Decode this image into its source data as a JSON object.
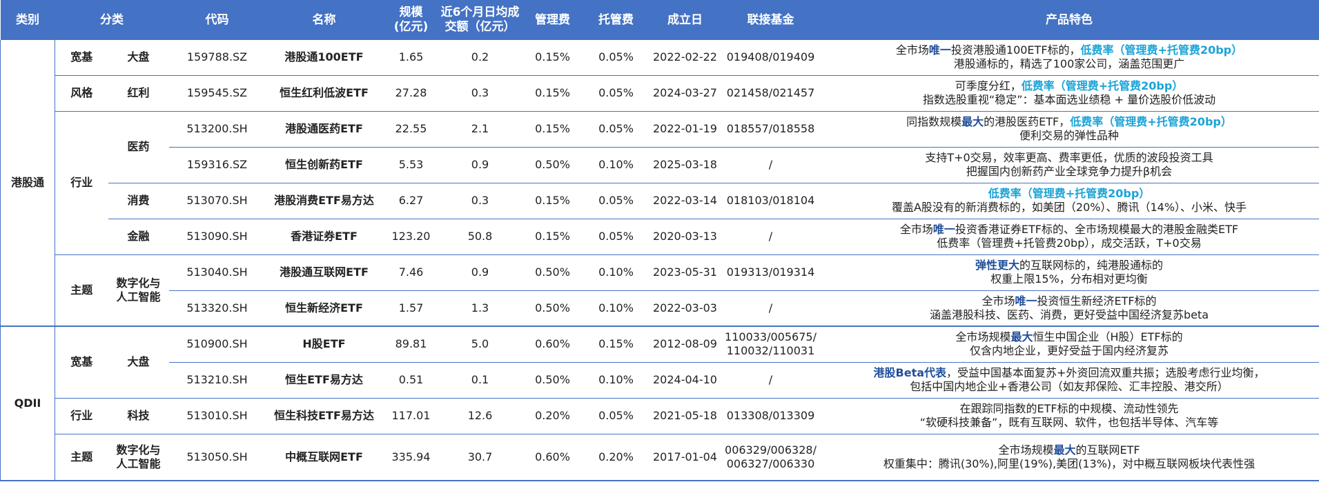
{
  "headers": [
    "类别",
    "分类",
    "代码",
    "名称",
    "规模\n(亿元)",
    "近6个月日均成\n交额（亿元）",
    "管理费",
    "托管费",
    "成立日",
    "联接基金",
    "产品特色"
  ],
  "groups": {
    "hk": "港股通",
    "qdii": "QDII"
  },
  "l1": {
    "kuanji": "宽基",
    "fengge": "风格",
    "hangye": "行业",
    "zhuti": "主题",
    "kuanji2": "宽基",
    "hangye2": "行业",
    "zhuti2": "主题"
  },
  "l2": {
    "dapan": "大盘",
    "hongli": "红利",
    "yiyao": "医药",
    "xiaofei": "消费",
    "jinrong": "金融",
    "shuzi": "数字化与\n人工智能",
    "dapan2": "大盘",
    "keji": "科技",
    "shuzi2": "数字化与\n人工智能"
  },
  "rows": [
    {
      "code": "159788.SZ",
      "name": "港股通100ETF",
      "scale": "1.65",
      "volume": "0.2",
      "mgmt_fee": "0.15%",
      "custody_fee": "0.05%",
      "date": "2022-02-22",
      "link": "019408/019409",
      "f1a": "全市场",
      "f1b": "唯一",
      "f1c": "投资港股通100ETF标的，",
      "f1d": "低费率（管理费+托管费20bp）",
      "f2": "港股通标的，精选了100家公司，涵盖范围更广"
    },
    {
      "code": "159545.SZ",
      "name": "恒生红利低波ETF",
      "scale": "27.28",
      "volume": "0.3",
      "mgmt_fee": "0.15%",
      "custody_fee": "0.05%",
      "date": "2024-03-27",
      "link": "021458/021457",
      "f1a": "可季度分红，",
      "f1b": "低费率（管理费+托管费20bp）",
      "f2": "指数选股重视“稳定”：基本面选业绩稳 + 量价选股价低波动"
    },
    {
      "code": "513200.SH",
      "name": "港股通医药ETF",
      "scale": "22.55",
      "volume": "2.1",
      "mgmt_fee": "0.15%",
      "custody_fee": "0.05%",
      "date": "2022-01-19",
      "link": "018557/018558",
      "f1a": "同指数规模",
      "f1b": "最大",
      "f1c": "的港股医药ETF，",
      "f1d": "低费率（管理费+托管费20bp）",
      "f2": "便利交易的弹性品种"
    },
    {
      "code": "159316.SZ",
      "name": "恒生创新药ETF",
      "scale": "5.53",
      "volume": "0.9",
      "mgmt_fee": "0.50%",
      "custody_fee": "0.10%",
      "date": "2025-03-18",
      "link": "/",
      "f1": "支持T+0交易，效率更高、费率更低，优质的波段投资工具",
      "f2": "把握国内创新药产业全球竞争力提升β机会"
    },
    {
      "code": "513070.SH",
      "name": "港股消费ETF易方达",
      "scale": "6.27",
      "volume": "0.3",
      "mgmt_fee": "0.15%",
      "custody_fee": "0.05%",
      "date": "2022-03-14",
      "link": "018103/018104",
      "f1": "低费率（管理费+托管费20bp）",
      "f2": "覆盖A股没有的新消费标的，如美团（20%）、腾讯（14%）、小米、快手"
    },
    {
      "code": "513090.SH",
      "name": "香港证券ETF",
      "scale": "123.20",
      "volume": "50.8",
      "mgmt_fee": "0.15%",
      "custody_fee": "0.05%",
      "date": "2020-03-13",
      "link": "/",
      "f1a": "全市场",
      "f1b": "唯一",
      "f1c": "投资香港证券ETF标的、全市场规模最大的港股金融类ETF",
      "f2": "低费率（管理费+托管费20bp），成交活跃，T+0交易"
    },
    {
      "code": "513040.SH",
      "name": "港股通互联网ETF",
      "scale": "7.46",
      "volume": "0.9",
      "mgmt_fee": "0.50%",
      "custody_fee": "0.10%",
      "date": "2023-05-31",
      "link": "019313/019314",
      "f1a": "弹性更大",
      "f1b": "的互联网标的，纯港股通标的",
      "f2": "权重上限15%，分布相对更均衡"
    },
    {
      "code": "513320.SH",
      "name": "恒生新经济ETF",
      "scale": "1.57",
      "volume": "1.3",
      "mgmt_fee": "0.50%",
      "custody_fee": "0.10%",
      "date": "2022-03-03",
      "link": "/",
      "f1a": "全市场",
      "f1b": "唯一",
      "f1c": "投资恒生新经济ETF标的",
      "f2": "涵盖港股科技、医药、消费，更好受益中国经济复苏beta"
    },
    {
      "code": "510900.SH",
      "name": "H股ETF",
      "scale": "89.81",
      "volume": "5.0",
      "mgmt_fee": "0.60%",
      "custody_fee": "0.15%",
      "date": "2012-08-09",
      "link1": "110033/005675/",
      "link2": "110032/110031",
      "f1a": "全市场规模",
      "f1b": "最大",
      "f1c": "恒生中国企业（H股）ETF标的",
      "f2": "仅含内地企业，更好受益于国内经济复苏"
    },
    {
      "code": "513210.SH",
      "name": "恒生ETF易方达",
      "scale": "0.51",
      "volume": "0.1",
      "mgmt_fee": "0.50%",
      "custody_fee": "0.10%",
      "date": "2024-04-10",
      "link": "/",
      "f1a": "港股Beta代表",
      "f1b": "，受益中国基本面复苏+外资回流双重共振；选股考虑行业均衡，",
      "f2": "包括中国内地企业+香港公司（如友邦保险、汇丰控股、港交所）"
    },
    {
      "code": "513010.SH",
      "name": "恒生科技ETF易方达",
      "scale": "117.01",
      "volume": "12.6",
      "mgmt_fee": "0.20%",
      "custody_fee": "0.05%",
      "date": "2021-05-18",
      "link": "013308/013309",
      "f1": "在跟踪同指数的ETF标的中规模、流动性领先",
      "f2": "“软硬科技兼备”，既有互联网、软件，也包括半导体、汽车等"
    },
    {
      "code": "513050.SH",
      "name": "中概互联网ETF",
      "scale": "335.94",
      "volume": "30.7",
      "mgmt_fee": "0.60%",
      "custody_fee": "0.20%",
      "date": "2017-01-04",
      "link1": "006329/006328/",
      "link2": "006327/006330",
      "f1a": "全市场规模",
      "f1b": "最大",
      "f1c": "的互联网ETF",
      "f2": "权重集中：腾讯(30%),阿里(19%),美团(13%)，对中概互联网板块代表性强"
    }
  ]
}
